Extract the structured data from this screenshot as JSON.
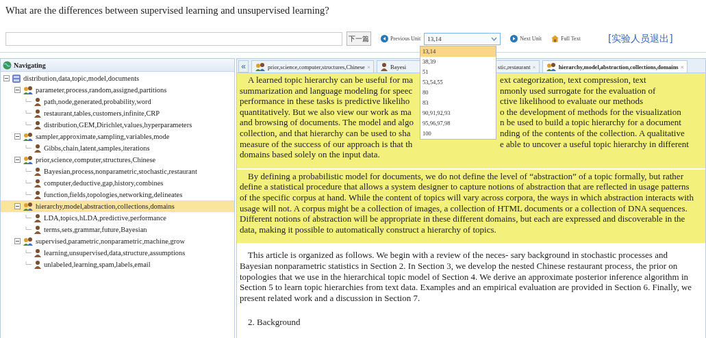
{
  "question": "What are the differences between supervised learning and unsupervised learning?",
  "toolbar": {
    "next_article": "下一篇",
    "previous_unit": "Previous Unit",
    "unit_select": {
      "value": "13,14",
      "expanded": true,
      "options": [
        {
          "label": "13,14",
          "selected": true
        },
        {
          "label": "38,39",
          "selected": false
        },
        {
          "label": "51",
          "selected": false
        },
        {
          "label": "53,54,55",
          "selected": false
        },
        {
          "label": "80",
          "selected": false
        },
        {
          "label": "83",
          "selected": false
        },
        {
          "label": "90,91,92,93",
          "selected": false
        },
        {
          "label": "95,96,97,98",
          "selected": false
        },
        {
          "label": "100",
          "selected": false
        }
      ]
    },
    "next_unit": "Next Unit",
    "full_text": "Full Text",
    "logout": "[实验人员退出]"
  },
  "sidebar": {
    "title": "Navigating",
    "tree": [
      {
        "label": "distribution,data,topic,model,documents",
        "kind": "root",
        "expanded": true,
        "selected": false,
        "children": [
          {
            "label": "parameter,process,random,assigned,partitions",
            "kind": "topic",
            "expanded": true,
            "selected": false,
            "children": [
              {
                "label": "path,node,generated,probability,word",
                "kind": "leaf",
                "selected": false
              },
              {
                "label": "restaurant,tables,customers,infinite,CRP",
                "kind": "leaf",
                "selected": false
              },
              {
                "label": "distribution,GEM,Dirichlet,values,hyperparameters",
                "kind": "leaf",
                "selected": false
              }
            ]
          },
          {
            "label": "sampler,approximate,sampling,variables,mode",
            "kind": "topic",
            "expanded": true,
            "selected": false,
            "children": [
              {
                "label": "Gibbs,chain,latent,samples,iterations",
                "kind": "leaf",
                "selected": false
              }
            ]
          },
          {
            "label": "prior,science,computer,structures,Chinese",
            "kind": "topic",
            "expanded": true,
            "selected": false,
            "children": [
              {
                "label": "Bayesian,process,nonparametric,stochastic,restaurant",
                "kind": "leaf",
                "selected": false
              },
              {
                "label": "computer,deductive,gap,history,combines",
                "kind": "leaf",
                "selected": false
              },
              {
                "label": "function,fields,topologies,networking,delineates",
                "kind": "leaf",
                "selected": false
              }
            ]
          },
          {
            "label": "hierarchy,model,abstraction,collections,domains",
            "kind": "topic",
            "expanded": true,
            "selected": true,
            "children": [
              {
                "label": "LDA,topics,hLDA,predictive,performance",
                "kind": "leaf",
                "selected": false
              },
              {
                "label": "terms,sets,grammar,future,Bayesian",
                "kind": "leaf",
                "selected": false
              }
            ]
          },
          {
            "label": "supervised,parametric,nonparametric,machine,grow",
            "kind": "topic",
            "expanded": true,
            "selected": false,
            "children": [
              {
                "label": "learning,unsupervised,data,structure,assumptions",
                "kind": "leaf",
                "selected": false
              },
              {
                "label": "unlabeled,learning,spam,labels,email",
                "kind": "leaf",
                "selected": false
              }
            ]
          }
        ]
      }
    ]
  },
  "tabs": [
    {
      "kind": "topic",
      "label": "prior,science,computer,structures,Chinese",
      "close": "×",
      "selected": false
    },
    {
      "kind": "leaf",
      "label": "Bayesi",
      "label_right": "stic,restaurant",
      "close": "×",
      "selected": false
    },
    {
      "kind": "topic",
      "label": "hierarchy,model,abstraction,collections,domains",
      "close": "×",
      "selected": true
    }
  ],
  "collapse_button": "«",
  "paragraphs": [
    {
      "highlighted": true,
      "lines": [
        {
          "left": "A learned topic hierarchy can be useful for ma",
          "right": "ext categorization, text compression, text"
        },
        {
          "left": "summarization and language modeling for speec",
          "right": "nmonly used surrogate for the evaluation of"
        },
        {
          "left": "performance in these tasks is predictive likeliho",
          "right": "ctive likelihood to evaluate our methods"
        },
        {
          "left": "quantitatively. But we also view our work as ma",
          "right": "o the development of methods for the visualization"
        },
        {
          "left": "and browsing of documents. The model and algo",
          "right": "n be used to build a topic hierarchy for a document"
        },
        {
          "left": "collection, and that hierarchy can be used to sha",
          "right": "nding of the contents of the collection. A qualitative"
        },
        {
          "left": "measure of the success of our approach is that th",
          "right": "e able to uncover a useful topic hierarchy in different"
        },
        {
          "left": "domains based solely on the input data."
        }
      ]
    },
    {
      "highlighted": true,
      "text": "By defining a probabilistic model for documents, we do not define the level of “abstraction” of a topic formally, but rather define a statistical procedure that allows a system designer to capture notions of abstraction that are reflected in usage patterns of the specific corpus at hand. While the content of topics will vary across corpora, the ways in which abstraction interacts with usage will not. A corpus might be a collection of images, a collection of HTML documents or a collection of DNA sequences. Different notions of abstraction will be appropriate in these different domains, but each are expressed and discoverable in the data, making it possible to automatically construct a hierarchy of topics."
    },
    {
      "highlighted": false,
      "text": "This article is organized as follows. We begin with a review of the neces- sary background in stochastic processes and Bayesian nonparametric statistics in Section 2. In Section 3, we develop the nested Chinese restaurant process, the prior on topologies that we use in the hierarchical topic model of Section 4. We derive an approximate posterior inference algorithm in Section 5 to learn topic hierarchies from text data. Examples and an empirical evaluation are provided in Section 6. Finally, we present related work and a discussion in Section 7."
    },
    {
      "highlighted": false,
      "text": "2. Background"
    }
  ]
}
